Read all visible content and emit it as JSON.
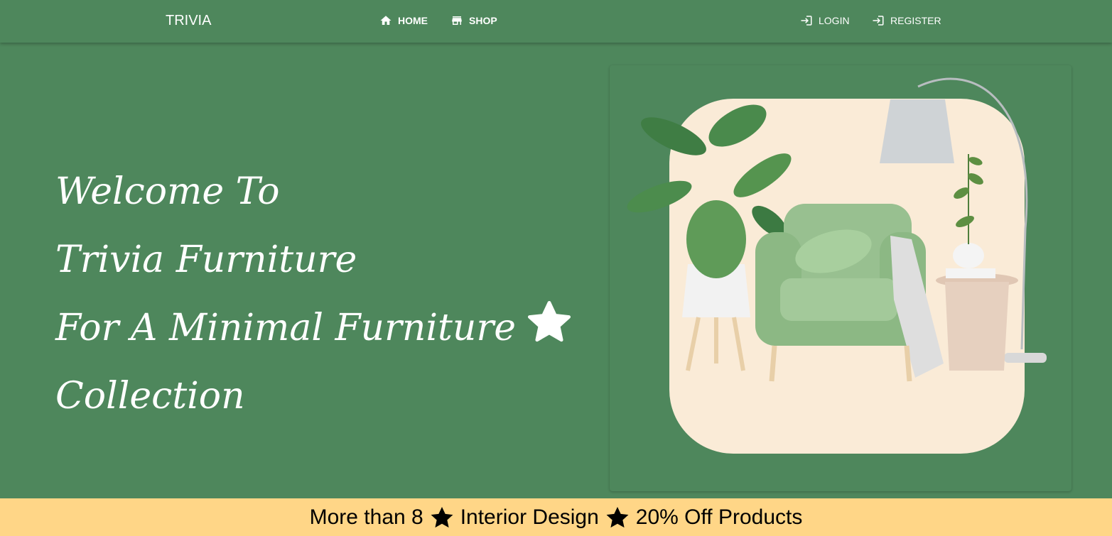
{
  "nav": {
    "brand": "TRIVIA",
    "home_label": "HOME",
    "shop_label": "SHOP",
    "login_label": "LOGIN",
    "register_label": "REGISTER",
    "icons": [
      "home-icon",
      "store-icon",
      "login-icon",
      "register-icon"
    ]
  },
  "hero": {
    "line1": "Welcome To",
    "line2": "Trivia Furniture",
    "line3": "For A Minimal Furniture",
    "line4": "Collection",
    "icon": "star-icon"
  },
  "banner": {
    "part1": "More than 8",
    "part2": "Interior Design",
    "part3": "20% Off Products",
    "icon": "star-icon"
  },
  "colors": {
    "primary": "#4e875c",
    "banner": "#ffd687",
    "card_bg": "#faebd7",
    "chair": "#98c090"
  }
}
